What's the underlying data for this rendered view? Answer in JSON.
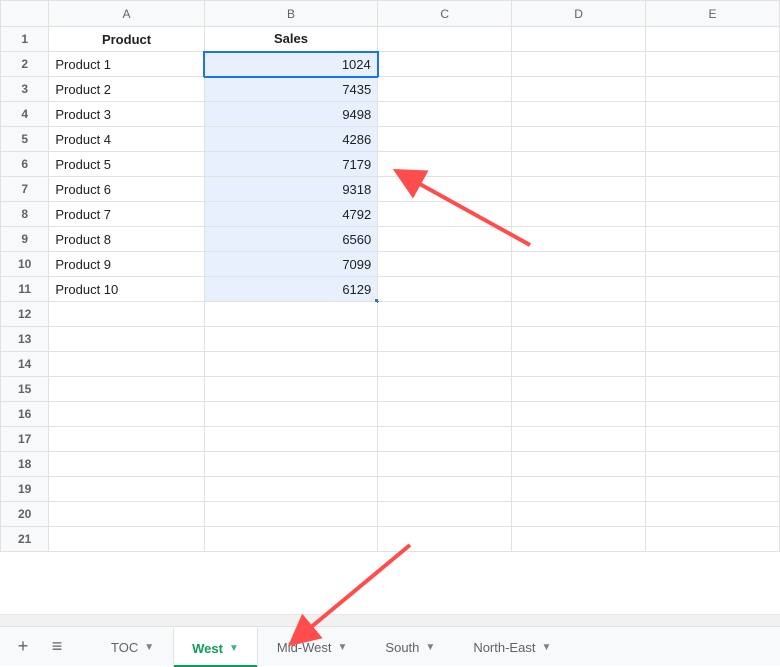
{
  "columns": [
    "A",
    "B",
    "C",
    "D",
    "E"
  ],
  "headers": {
    "A": "Product",
    "B": "Sales"
  },
  "rows": [
    {
      "product": "Product 1",
      "sales": 1024
    },
    {
      "product": "Product 2",
      "sales": 7435
    },
    {
      "product": "Product 3",
      "sales": 9498
    },
    {
      "product": "Product 4",
      "sales": 4286
    },
    {
      "product": "Product 5",
      "sales": 7179
    },
    {
      "product": "Product 6",
      "sales": 9318
    },
    {
      "product": "Product 7",
      "sales": 4792
    },
    {
      "product": "Product 8",
      "sales": 6560
    },
    {
      "product": "Product 9",
      "sales": 7099
    },
    {
      "product": "Product 10",
      "sales": 6129
    }
  ],
  "visible_row_count": 21,
  "active_cell": "B2",
  "selection": "B2:B11",
  "tabs": [
    {
      "name": "TOC",
      "active": false
    },
    {
      "name": "West",
      "active": true
    },
    {
      "name": "Mid-West",
      "active": false
    },
    {
      "name": "South",
      "active": false
    },
    {
      "name": "North-East",
      "active": false
    }
  ],
  "icons": {
    "add": "+",
    "menu": "≡"
  },
  "col_widths": {
    "A": 160,
    "B": 180,
    "C": 140,
    "D": 140,
    "E": 140
  }
}
